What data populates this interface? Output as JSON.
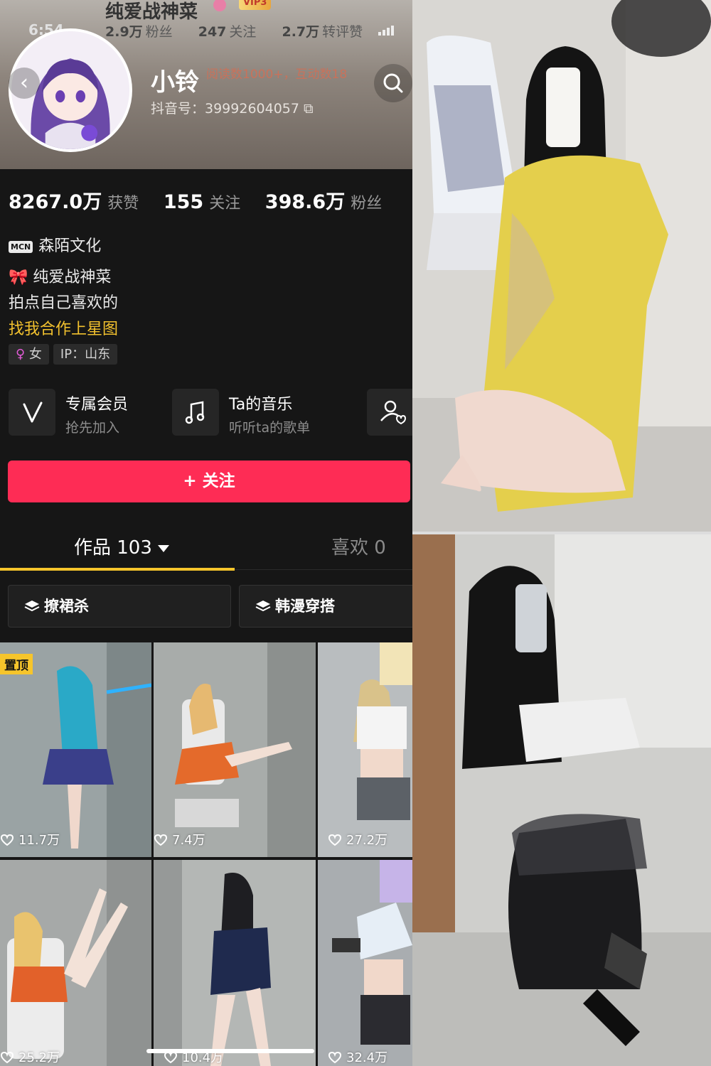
{
  "status_bar": {
    "time": "6:54"
  },
  "header": {
    "title": "纯爱战神菜",
    "vip_label": "VIP3",
    "mini_stats": [
      {
        "value": "2.9万",
        "label": "粉丝"
      },
      {
        "value": "247",
        "label": "关注"
      },
      {
        "value": "2.7万",
        "label": "转评赞"
      }
    ],
    "notice": "阅读数1000+，互动数18"
  },
  "profile": {
    "nickname": "小铃",
    "douyin_id": "抖音号：39992604057",
    "stats": [
      {
        "value": "8267.0万",
        "label": "获赞"
      },
      {
        "value": "155",
        "label": "关注"
      },
      {
        "value": "398.6万",
        "label": "粉丝"
      }
    ],
    "mcn_tag": "MCN",
    "mcn_name": "森陌文化",
    "bio": [
      "🎀 纯爱战神菜",
      "拍点自己喜欢的",
      "找我合作上星图"
    ],
    "gender_symbol": "♀",
    "gender": "女",
    "ip": "IP：山东"
  },
  "features": [
    {
      "title": "专属会员",
      "subtitle": "抢先加入",
      "icon": "v-icon"
    },
    {
      "title": "Ta的音乐",
      "subtitle": "听听ta的歌单",
      "icon": "music-note-icon"
    }
  ],
  "follow_button": "+ 关注",
  "tabs": [
    {
      "label": "作品 103",
      "active": true
    },
    {
      "label": "喜欢 0",
      "active": false
    }
  ],
  "collections": [
    "撩裙杀",
    "韩漫穿搭"
  ],
  "videos": [
    {
      "likes": "11.7万",
      "pinned": true,
      "pin_label": "置顶"
    },
    {
      "likes": "7.4万",
      "pinned": false
    },
    {
      "likes": "27.2万",
      "pinned": false
    },
    {
      "likes": "25.2万",
      "pinned": false
    },
    {
      "likes": "10.4万",
      "pinned": false
    },
    {
      "likes": "32.4万",
      "pinned": false
    }
  ],
  "colors": {
    "accent": "#fe2c55",
    "tab_indicator": "#f6c52b",
    "background": "#161616"
  }
}
